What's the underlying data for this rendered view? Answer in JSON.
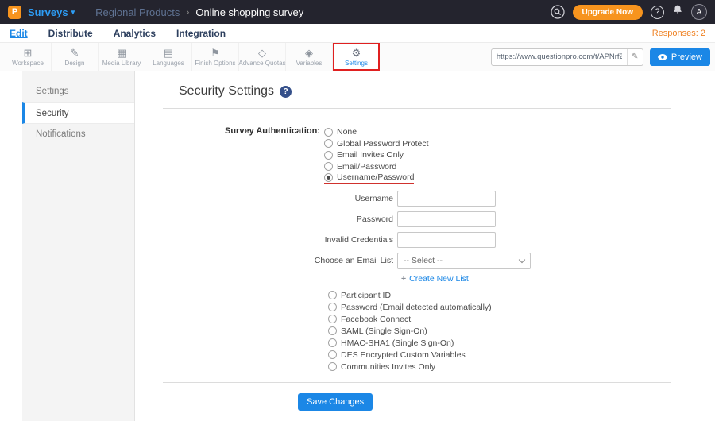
{
  "topbar": {
    "logo_letter": "P",
    "product_menu": "Surveys",
    "menu_caret": "▾",
    "breadcrumb_parent": "Regional Products",
    "breadcrumb_separator": "›",
    "breadcrumb_current": "Online shopping survey",
    "upgrade_label": "Upgrade Now",
    "help_label": "?",
    "avatar_letter": "A"
  },
  "navbar": {
    "items": [
      {
        "label": "Edit",
        "active": true
      },
      {
        "label": "Distribute",
        "active": false
      },
      {
        "label": "Analytics",
        "active": false
      },
      {
        "label": "Integration",
        "active": false
      }
    ],
    "responses": "Responses: 2"
  },
  "toolbar": {
    "items": [
      {
        "label": "Workspace",
        "icon": "workspace-icon",
        "glyph": "⊞"
      },
      {
        "label": "Design",
        "icon": "design-icon",
        "glyph": "✎"
      },
      {
        "label": "Media Library",
        "icon": "media-library-icon",
        "glyph": "▦"
      },
      {
        "label": "Languages",
        "icon": "languages-icon",
        "glyph": "▤"
      },
      {
        "label": "Finish Options",
        "icon": "finish-options-icon",
        "glyph": "⚑"
      },
      {
        "label": "Advance Quotas",
        "icon": "advance-quotas-icon",
        "glyph": "◇"
      },
      {
        "label": "Variables",
        "icon": "variables-icon",
        "glyph": "◈"
      },
      {
        "label": "Settings",
        "icon": "settings-icon",
        "glyph": "⚙",
        "active": true
      }
    ],
    "url_value": "https://www.questionpro.com/t/APNrfZ",
    "edit_glyph": "✎",
    "preview_label": "Preview"
  },
  "sidebar": {
    "items": [
      {
        "label": "Settings",
        "active": false
      },
      {
        "label": "Security",
        "active": true
      },
      {
        "label": "Notifications",
        "active": false
      }
    ]
  },
  "main": {
    "title": "Security Settings",
    "help_label": "?",
    "auth_label": "Survey Authentication:",
    "auth_options": [
      {
        "label": "None",
        "selected": false
      },
      {
        "label": "Global Password Protect",
        "selected": false
      },
      {
        "label": "Email Invites Only",
        "selected": false
      },
      {
        "label": "Email/Password",
        "selected": false
      },
      {
        "label": "Username/Password",
        "selected": true
      }
    ],
    "fields": {
      "username_label": "Username",
      "username_value": "",
      "password_label": "Password",
      "password_value": "",
      "invalid_credentials_label": "Invalid Credentials",
      "invalid_credentials_value": "",
      "email_list_label": "Choose an Email List",
      "email_list_value": "-- Select --"
    },
    "create_list_plus": "+",
    "create_list_label": "Create New List",
    "more_options": [
      {
        "label": "Participant ID",
        "selected": false
      },
      {
        "label": "Password (Email detected automatically)",
        "selected": false
      },
      {
        "label": "Facebook Connect",
        "selected": false
      },
      {
        "label": "SAML (Single Sign-On)",
        "selected": false
      },
      {
        "label": "HMAC-SHA1 (Single Sign-On)",
        "selected": false
      },
      {
        "label": "DES Encrypted Custom Variables",
        "selected": false
      },
      {
        "label": "Communities Invites Only",
        "selected": false
      }
    ],
    "save_label": "Save Changes"
  },
  "colors": {
    "accent_blue": "#1b87e6",
    "brand_orange": "#f7941e",
    "topbar_dark": "#24242e",
    "annotation_red": "#e02020"
  }
}
